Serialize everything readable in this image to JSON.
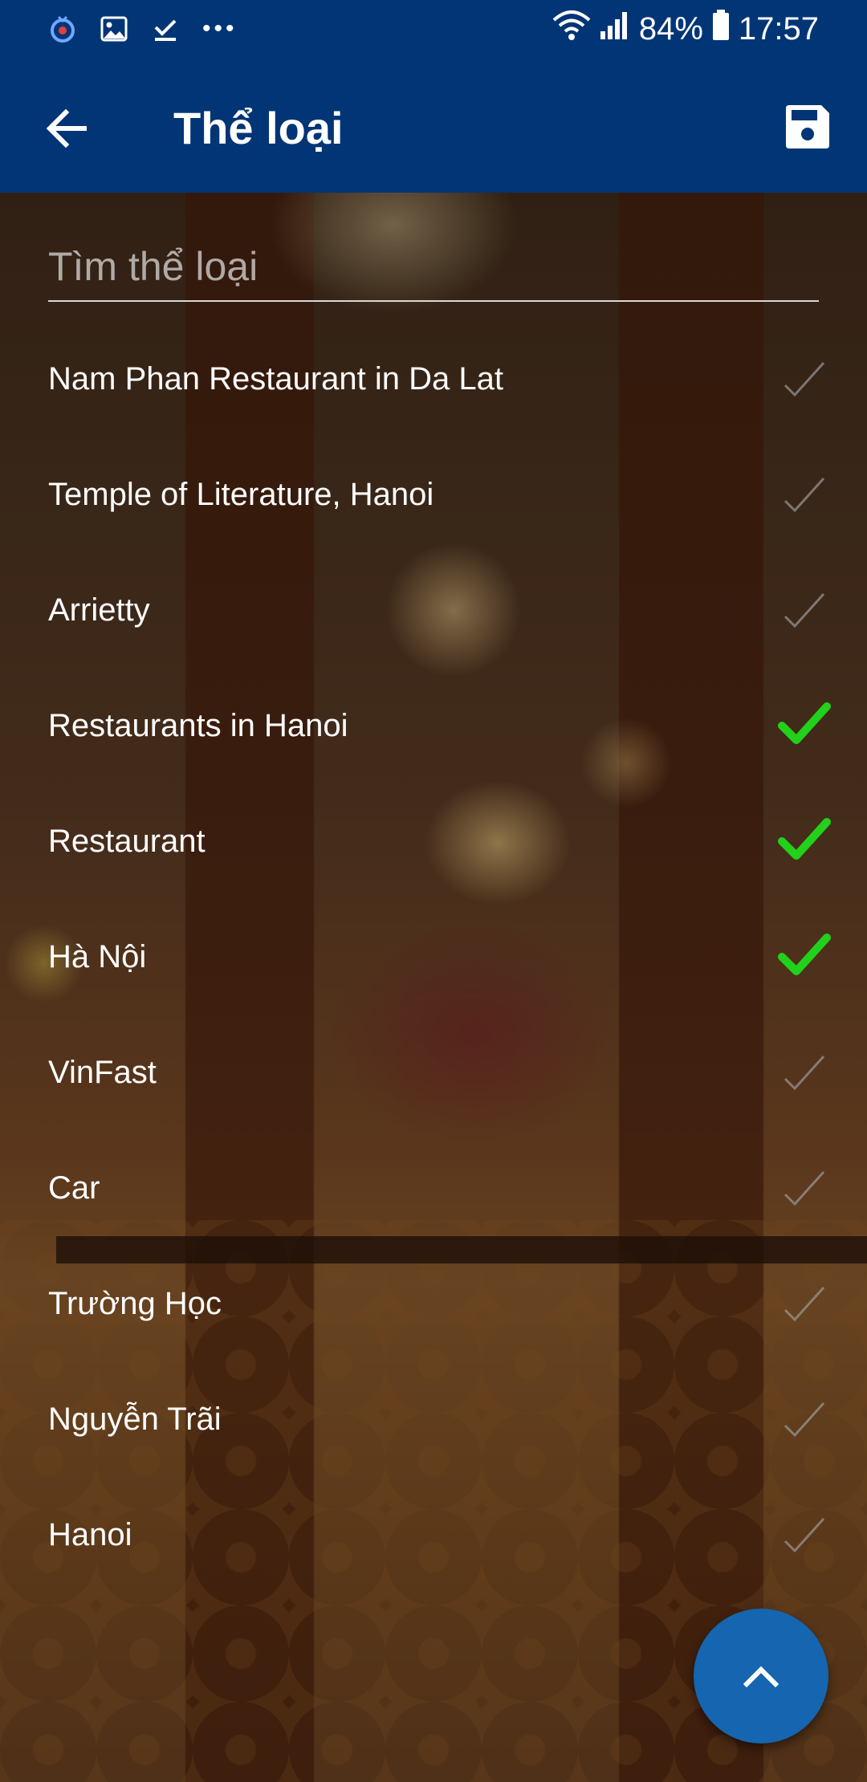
{
  "status_bar": {
    "battery": "84%",
    "time": "17:57",
    "left_icons": [
      "alarm-icon",
      "image-icon",
      "download-check-icon",
      "more-dots-icon"
    ],
    "right_icons": [
      "wifi-icon",
      "signal-icon",
      "battery-icon"
    ]
  },
  "app_bar": {
    "title": "Thể loại",
    "back_icon": "arrow-left-icon",
    "save_icon": "floppy-disk-icon",
    "color": "#023576"
  },
  "search": {
    "placeholder": "Tìm thể loại",
    "value": ""
  },
  "categories": [
    {
      "label": "Nam Phan Restaurant in Da Lat",
      "selected": false
    },
    {
      "label": "Temple of Literature, Hanoi",
      "selected": false
    },
    {
      "label": "Arrietty",
      "selected": false
    },
    {
      "label": "Restaurants in Hanoi",
      "selected": true
    },
    {
      "label": "Restaurant",
      "selected": true
    },
    {
      "label": "Hà Nội",
      "selected": true
    },
    {
      "label": "VinFast",
      "selected": false
    },
    {
      "label": "Car",
      "selected": false
    },
    {
      "label": "Trường Học",
      "selected": false
    },
    {
      "label": "Nguyễn Trãi",
      "selected": false
    },
    {
      "label": "Hanoi",
      "selected": false
    }
  ],
  "colors": {
    "check_selected": "#22d11a",
    "check_unselected": "#9a9a9a",
    "fab": "#1565b0"
  },
  "fab": {
    "icon": "chevron-up-icon"
  }
}
